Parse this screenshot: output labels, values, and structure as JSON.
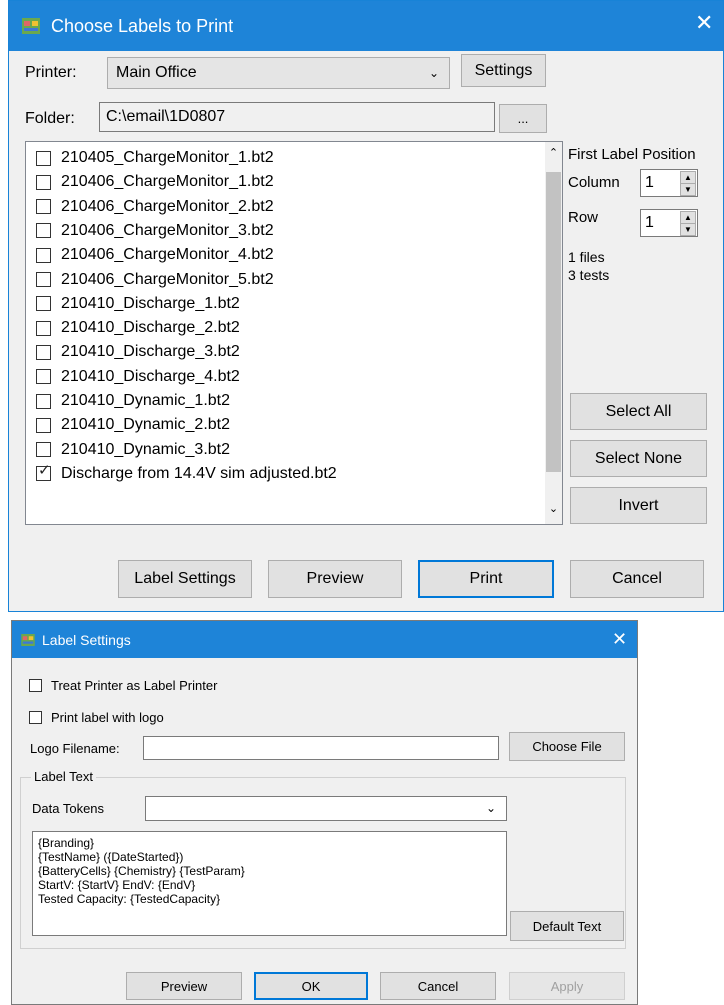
{
  "choose_dialog": {
    "title": "Choose Labels to Print",
    "close_glyph": "✕",
    "printer_label": "Printer:",
    "printer_value": "Main Office",
    "settings_label": "Settings",
    "folder_label": "Folder:",
    "folder_value": "C:\\email\\1D0807",
    "browse_label": "...",
    "files": [
      {
        "name": "210405_ChargeMonitor_1.bt2",
        "checked": false
      },
      {
        "name": "210406_ChargeMonitor_1.bt2",
        "checked": false
      },
      {
        "name": "210406_ChargeMonitor_2.bt2",
        "checked": false
      },
      {
        "name": "210406_ChargeMonitor_3.bt2",
        "checked": false
      },
      {
        "name": "210406_ChargeMonitor_4.bt2",
        "checked": false
      },
      {
        "name": "210406_ChargeMonitor_5.bt2",
        "checked": false
      },
      {
        "name": "210410_Discharge_1.bt2",
        "checked": false
      },
      {
        "name": "210410_Discharge_2.bt2",
        "checked": false
      },
      {
        "name": "210410_Discharge_3.bt2",
        "checked": false
      },
      {
        "name": "210410_Discharge_4.bt2",
        "checked": false
      },
      {
        "name": "210410_Dynamic_1.bt2",
        "checked": false
      },
      {
        "name": "210410_Dynamic_2.bt2",
        "checked": false
      },
      {
        "name": "210410_Dynamic_3.bt2",
        "checked": false
      },
      {
        "name": "Discharge from 14.4V sim adjusted.bt2",
        "checked": true
      }
    ],
    "first_label_position": "First Label Position",
    "column_label": "Column",
    "column_value": "1",
    "row_label": "Row",
    "row_value": "1",
    "files_count": "1 files",
    "tests_count": "3 tests",
    "select_all": "Select All",
    "select_none": "Select None",
    "invert": "Invert",
    "label_settings": "Label Settings",
    "preview": "Preview",
    "print": "Print",
    "cancel": "Cancel"
  },
  "settings_dialog": {
    "title": "Label Settings",
    "close_glyph": "✕",
    "treat_printer": "Treat Printer as Label Printer",
    "treat_printer_checked": false,
    "print_logo": "Print label with logo",
    "print_logo_checked": false,
    "logo_filename_label": "Logo Filename:",
    "logo_filename_value": "",
    "choose_file": "Choose File",
    "label_text_group": "Label Text",
    "data_tokens_label": "Data Tokens",
    "data_tokens_value": "",
    "label_text": "{Branding}\n{TestName} ({DateStarted})\n{BatteryCells} {Chemistry} {TestParam}\nStartV: {StartV} EndV: {EndV}\nTested Capacity: {TestedCapacity}",
    "default_text": "Default Text",
    "preview": "Preview",
    "ok": "OK",
    "cancel": "Cancel",
    "apply": "Apply"
  },
  "icons": {
    "app_icon": "app-icon",
    "dropdown": "chevron-down-icon",
    "scroll_up": "chevron-up-icon",
    "scroll_down": "chevron-down-icon"
  },
  "colors": {
    "titlebar": "#1e84d8",
    "dialog_bg": "#f0f0f0",
    "default_button_border": "#0078d7"
  }
}
